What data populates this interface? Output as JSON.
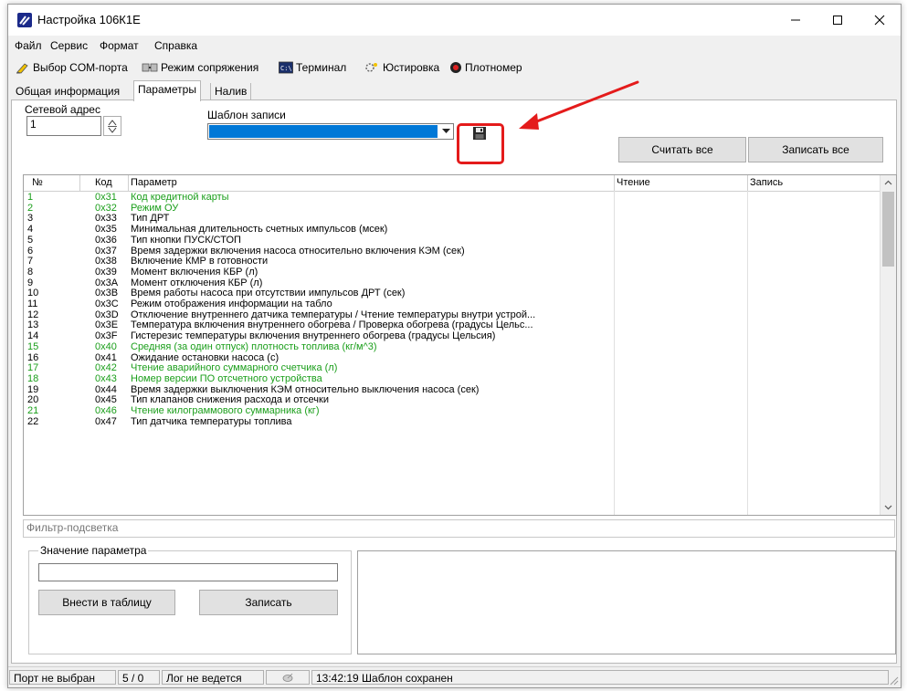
{
  "window": {
    "title": "Настройка 106К1Е",
    "controls": {
      "minimize": "—",
      "maximize": "☐",
      "close": "✕"
    }
  },
  "menu": [
    "Файл",
    "Сервис",
    "Формат",
    "Справка"
  ],
  "toolbar": [
    {
      "label": "Выбор COM-порта",
      "icon": "com-port-icon"
    },
    {
      "label": "Режим сопряжения",
      "icon": "pairing-icon"
    },
    {
      "label": "Терминал",
      "icon": "terminal-icon",
      "badge": "C:\\"
    },
    {
      "label": "Юстировка",
      "icon": "calibration-icon"
    },
    {
      "label": "Плотномер",
      "icon": "densimeter-icon"
    }
  ],
  "tabs": [
    "Общая информация",
    "Параметры",
    "Налив"
  ],
  "active_tab": 1,
  "params": {
    "network_label": "Сетевой адрес",
    "network_value": "1",
    "template_label": "Шаблон записи",
    "template_value": "",
    "read_all": "Считать все",
    "write_all": "Записать все"
  },
  "table": {
    "headers": [
      "№",
      "Код",
      "Параметр",
      "Чтение",
      "Запись"
    ],
    "rows": [
      {
        "n": "1",
        "code": "0x31",
        "param": "Код кредитной карты",
        "green": true
      },
      {
        "n": "2",
        "code": "0x32",
        "param": "Режим ОУ",
        "green": true
      },
      {
        "n": "3",
        "code": "0x33",
        "param": "Тип ДРТ",
        "green": false
      },
      {
        "n": "4",
        "code": "0x35",
        "param": "Минимальная длительность счетных импульсов (мсек)",
        "green": false
      },
      {
        "n": "5",
        "code": "0x36",
        "param": "Тип кнопки ПУСК/СТОП",
        "green": false
      },
      {
        "n": "6",
        "code": "0x37",
        "param": "Время задержки включения насоса относительно включения КЭМ (сек)",
        "green": false
      },
      {
        "n": "7",
        "code": "0x38",
        "param": "Включение КМР в готовности",
        "green": false
      },
      {
        "n": "8",
        "code": "0x39",
        "param": "Момент включения КБР (л)",
        "green": false
      },
      {
        "n": "9",
        "code": "0x3A",
        "param": "Момент отключения КБР (л)",
        "green": false
      },
      {
        "n": "10",
        "code": "0x3B",
        "param": "Время работы насоса при отсутствии импульсов ДРТ (сек)",
        "green": false
      },
      {
        "n": "11",
        "code": "0x3C",
        "param": "Режим отображения информации на табло",
        "green": false
      },
      {
        "n": "12",
        "code": "0x3D",
        "param": "Отключение внутреннего датчика температуры / Чтение температуры внутри устрой...",
        "green": false
      },
      {
        "n": "13",
        "code": "0x3E",
        "param": "Температура включения внутреннего обогрева / Проверка обогрева (градусы Цельс...",
        "green": false
      },
      {
        "n": "14",
        "code": "0x3F",
        "param": "Гистерезис температуры включения внутреннего обогрева (градусы Цельсия)",
        "green": false
      },
      {
        "n": "15",
        "code": "0x40",
        "param": "Средняя (за один отпуск) плотность топлива (кг/м^3)",
        "green": true
      },
      {
        "n": "16",
        "code": "0x41",
        "param": "Ожидание остановки насоса (с)",
        "green": false
      },
      {
        "n": "17",
        "code": "0x42",
        "param": "Чтение аварийного суммарного счетчика (л)",
        "green": true
      },
      {
        "n": "18",
        "code": "0x43",
        "param": "Номер версии ПО отсчетного устройства",
        "green": true
      },
      {
        "n": "19",
        "code": "0x44",
        "param": "Время задержки выключения КЭМ относительно выключения насоса (сек)",
        "green": false
      },
      {
        "n": "20",
        "code": "0x45",
        "param": "Тип клапанов снижения расхода и отсечки",
        "green": false
      },
      {
        "n": "21",
        "code": "0x46",
        "param": "Чтение килограммового суммарника (кг)",
        "green": true
      },
      {
        "n": "22",
        "code": "0x47",
        "param": "Тип датчика температуры топлива",
        "green": false
      }
    ]
  },
  "filter": {
    "placeholder": "Фильтр-подсветка"
  },
  "value_group": {
    "legend": "Значение параметра",
    "value": "",
    "btn_insert": "Внести в таблицу",
    "btn_write": "Записать"
  },
  "status": {
    "port": "Порт не выбран",
    "counter": "5 / 0",
    "log": "Лог не ведется",
    "message": "13:42:19 Шаблон сохранен"
  },
  "colors": {
    "accent": "#0078d7",
    "green": "#1a9e1a",
    "arrow": "#e41b1b"
  }
}
